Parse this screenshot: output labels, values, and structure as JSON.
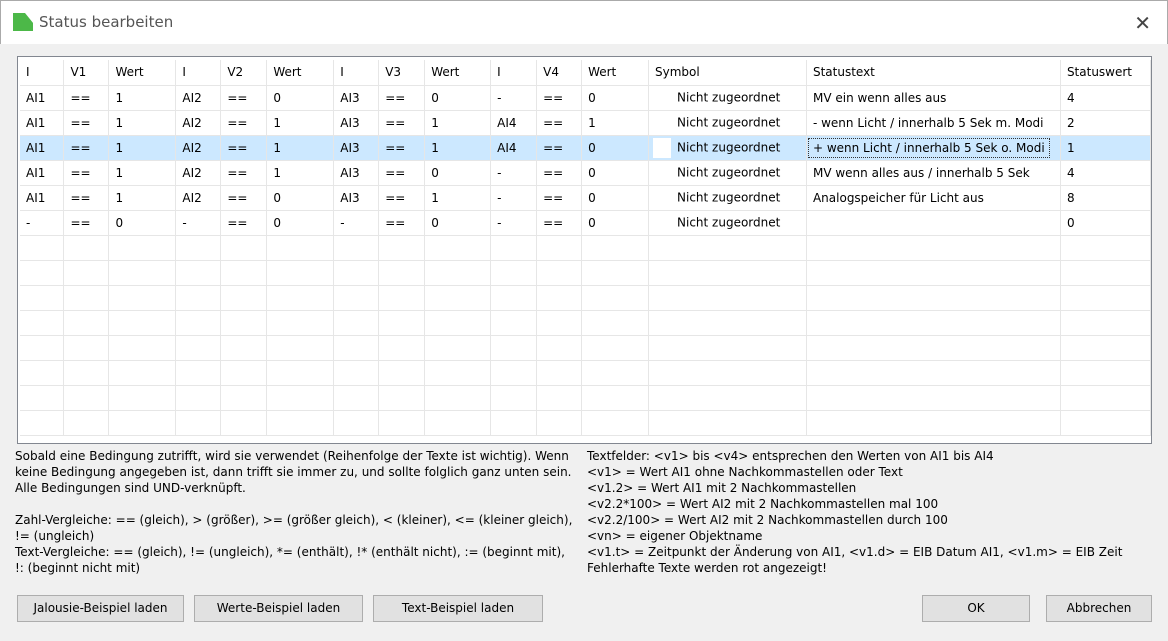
{
  "window": {
    "title": "Status bearbeiten",
    "close": "✕"
  },
  "table": {
    "headers": [
      "I",
      "V1",
      "Wert",
      "I",
      "V2",
      "Wert",
      "I",
      "V3",
      "Wert",
      "I",
      "V4",
      "Wert",
      "Symbol",
      "Statustext",
      "Statuswert"
    ],
    "rows": [
      [
        "AI1",
        "==",
        "1",
        "AI2",
        "==",
        "0",
        "AI3",
        "==",
        "0",
        "-",
        "==",
        "0",
        "Nicht zugeordnet",
        "MV ein wenn alles aus",
        "4"
      ],
      [
        "AI1",
        "==",
        "1",
        "AI2",
        "==",
        "1",
        "AI3",
        "==",
        "1",
        "AI4",
        "==",
        "1",
        "Nicht zugeordnet",
        "- wenn Licht / innerhalb 5 Sek m. Modi",
        "2"
      ],
      [
        "AI1",
        "==",
        "1",
        "AI2",
        "==",
        "1",
        "AI3",
        "==",
        "1",
        "AI4",
        "==",
        "0",
        "Nicht zugeordnet",
        "+ wenn Licht / innerhalb 5 Sek o. Modi",
        "1"
      ],
      [
        "AI1",
        "==",
        "1",
        "AI2",
        "==",
        "1",
        "AI3",
        "==",
        "0",
        "-",
        "==",
        "0",
        "Nicht zugeordnet",
        "MV wenn alles aus / innerhalb 5 Sek",
        "4"
      ],
      [
        "AI1",
        "==",
        "1",
        "AI2",
        "==",
        "0",
        "AI3",
        "==",
        "1",
        "-",
        "==",
        "0",
        "Nicht zugeordnet",
        "Analogspeicher für Licht aus",
        "8"
      ],
      [
        "-",
        "==",
        "0",
        "-",
        "==",
        "0",
        "-",
        "==",
        "0",
        "-",
        "==",
        "0",
        "Nicht zugeordnet",
        "",
        "0"
      ]
    ],
    "selected_row": 2
  },
  "help_left": "Sobald eine Bedingung zutrifft, wird sie verwendet (Reihenfolge der Texte ist wichtig). Wenn\nkeine Bedingung angegeben ist, dann trifft sie immer zu, und sollte folglich ganz unten sein.\nAlle Bedingungen sind UND-verknüpft.\n\nZahl-Vergleiche: == (gleich), > (größer), >= (größer gleich), < (kleiner), <= (kleiner gleich),\n!= (ungleich)\nText-Vergleiche: == (gleich), != (ungleich), *= (enthält), !* (enthält nicht), := (beginnt mit),\n!: (beginnt nicht mit)",
  "help_right": "Textfelder: <v1> bis <v4> entsprechen den Werten von AI1 bis AI4\n<v1> = Wert AI1 ohne Nachkommastellen oder Text\n<v1.2> = Wert AI1 mit 2 Nachkommastellen\n<v2.2*100> = Wert AI2 mit 2 Nachkommastellen mal 100\n<v2.2/100> = Wert AI2 mit 2 Nachkommastellen durch 100\n<vn> = eigener Objektname\n<v1.t> = Zeitpunkt der Änderung von AI1, <v1.d> = EIB Datum AI1, <v1.m> = EIB Zeit\nFehlerhafte Texte werden rot angezeigt!",
  "buttons": {
    "jalousie": "Jalousie-Beispiel laden",
    "werte": "Werte-Beispiel laden",
    "text": "Text-Beispiel laden",
    "ok": "OK",
    "cancel": "Abbrechen"
  }
}
